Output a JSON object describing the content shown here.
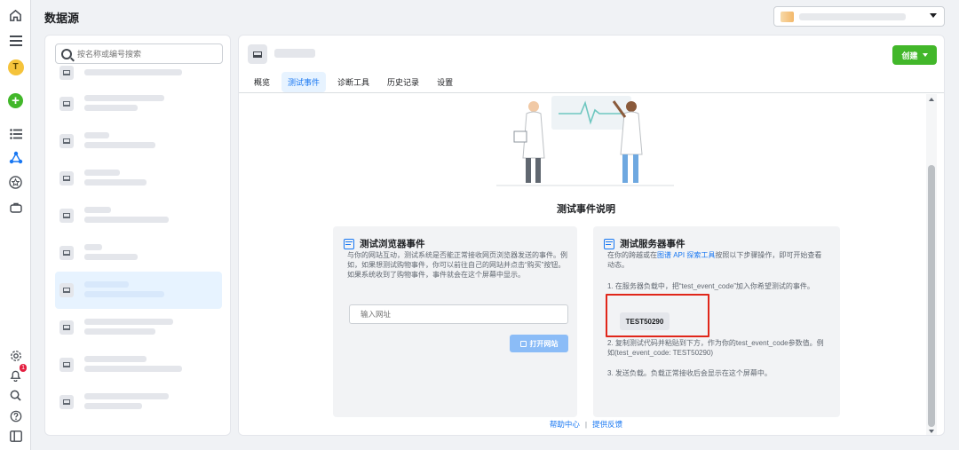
{
  "header": {
    "title": "数据源"
  },
  "sidebar": {
    "search_placeholder": "按名称或编号搜索"
  },
  "main": {
    "create_label": "创建",
    "tabs": [
      {
        "label": "概览"
      },
      {
        "label": "测试事件"
      },
      {
        "label": "诊断工具"
      },
      {
        "label": "历史记录"
      },
      {
        "label": "设置"
      }
    ],
    "section_title": "测试事件说明",
    "browser_card": {
      "title": "测试浏览器事件",
      "description": "与你的网站互动，测试系统是否能正常接收网页浏览器发送的事件。例如，如果想测试购物事件，你可以前往自己的网站并点击“购买”按钮。如果系统收到了购物事件，事件就会在这个屏幕中显示。",
      "url_placeholder": "输入网址",
      "open_label": "打开网站"
    },
    "server_card": {
      "title": "测试服务器事件",
      "desc_prefix": "在你的跨越或在",
      "desc_link": "图谱 API 探索工具",
      "desc_suffix": "按照以下步骤操作，即可开始查看动态。",
      "step1": "1. 在服务器负载中，把“test_event_code”加入你希望测试的事件。",
      "test_code": "TEST50290",
      "step2": "2. 复制测试代码并粘贴到下方，作为你的test_event_code参数值。例如(test_event_code: TEST50290)",
      "step3": "3. 发送负载。负载正常接收后会显示在这个屏幕中。"
    },
    "footer": {
      "help": "帮助中心",
      "feedback": "提供反馈"
    }
  },
  "colors": {
    "accent": "#1877f2",
    "create": "#42b72a",
    "highlight": "#e0261a"
  }
}
